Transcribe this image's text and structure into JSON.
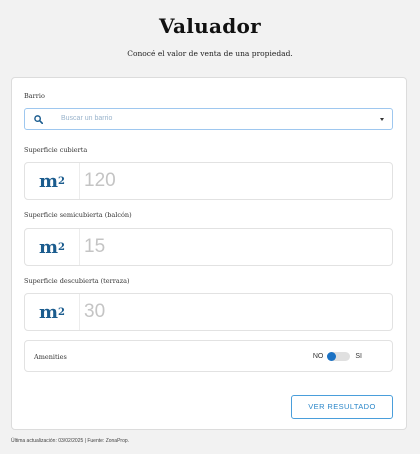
{
  "header": {
    "title": "Valuador",
    "subtitle": "Conocé el valor de venta de una propiedad."
  },
  "form": {
    "barrio": {
      "label": "Barrio",
      "placeholder": "Buscar un barrio",
      "icon": "search-icon"
    },
    "cubierta": {
      "label": "Superficie cubierta",
      "unit": "m",
      "unit_exp": "2",
      "placeholder": "120"
    },
    "semicubierta": {
      "label": "Superficie semicubierta (balcón)",
      "unit": "m",
      "unit_exp": "2",
      "placeholder": "15"
    },
    "descubierta": {
      "label": "Superficie descubierta (terraza)",
      "unit": "m",
      "unit_exp": "2",
      "placeholder": "30"
    },
    "amenities": {
      "label": "Amenities",
      "off_label": "NO",
      "on_label": "SI",
      "checked": false
    },
    "submit_label": "VER RESULTADO"
  },
  "footer": {
    "text": "Última actualización: 03/02/2025 | Fuente: ZonaProp."
  },
  "colors": {
    "accent": "#1c72c4",
    "unit": "#1b5c8e",
    "button": "#2a86c9"
  }
}
